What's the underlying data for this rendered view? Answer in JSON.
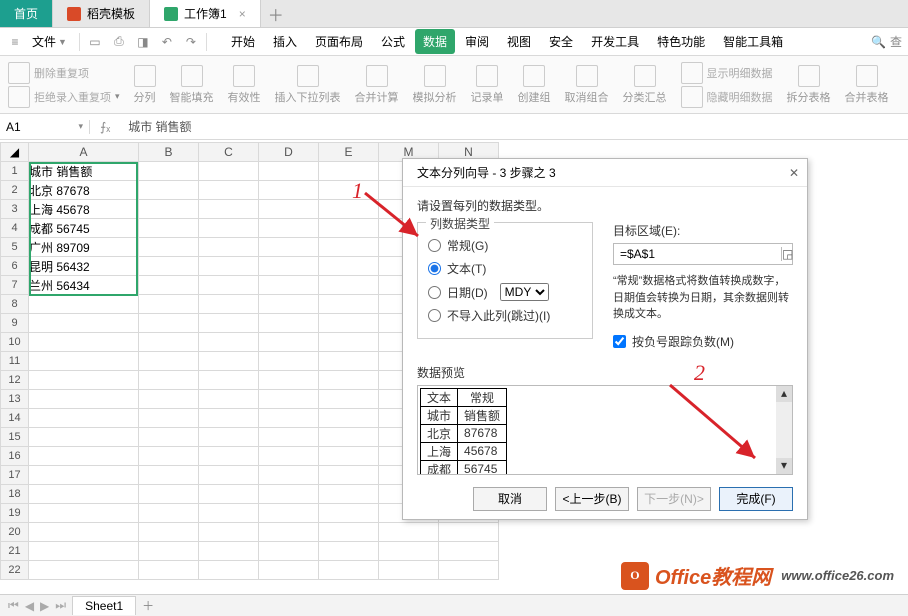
{
  "tabs": {
    "home": "首页",
    "docer": "稻壳模板",
    "workbook": "工作簿1"
  },
  "file_menu": "文件",
  "menus": [
    "开始",
    "插入",
    "页面布局",
    "公式",
    "数据",
    "审阅",
    "视图",
    "安全",
    "开发工具",
    "特色功能",
    "智能工具箱"
  ],
  "search_label": "查",
  "ribbon": {
    "dedup_btn": "删除重复项",
    "reject_dup": "拒绝录入重复项",
    "text_cols": "分列",
    "smartfill": "智能填充",
    "validity": "有效性",
    "insert_dd": "插入下拉列表",
    "consolidate": "合并计算",
    "whatif": "模拟分析",
    "record": "记录单",
    "group": "创建组",
    "ungroup": "取消组合",
    "subtotal": "分类汇总",
    "show_detail": "显示明细数据",
    "hide_detail": "隐藏明细数据",
    "split_tbl": "拆分表格",
    "merge_tbl": "合并表格"
  },
  "namebox": "A1",
  "formula": "城市  销售额",
  "columns": [
    "A",
    "B",
    "C",
    "D",
    "E",
    "M",
    "N"
  ],
  "data": [
    {
      "a": "城市  销售额"
    },
    {
      "a": "北京  87678"
    },
    {
      "a": "上海  45678"
    },
    {
      "a": "成都  56745"
    },
    {
      "a": "广州  89709"
    },
    {
      "a": "昆明  56432"
    },
    {
      "a": "兰州  56434"
    }
  ],
  "dialog": {
    "title": "文本分列向导 - 3 步骤之 3",
    "instruction": "请设置每列的数据类型。",
    "group_label": "列数据类型",
    "opt_general": "常规(G)",
    "opt_text": "文本(T)",
    "opt_date": "日期(D)",
    "date_fmt": "MDY",
    "opt_skip": "不导入此列(跳过)(I)",
    "dest_label": "目标区域(E):",
    "dest_value": "=$A$1",
    "hint": "“常规”数据格式将数值转换成数字，日期值会转换为日期，其余数据则转换成文本。",
    "chk_neg": "按负号跟踪负数(M)",
    "preview_label": "数据预览",
    "preview_headers": [
      "文本",
      "常规"
    ],
    "preview_rows": [
      [
        "城市",
        "销售额"
      ],
      [
        "北京",
        "87678"
      ],
      [
        "上海",
        "45678"
      ],
      [
        "成都",
        "56745"
      ]
    ],
    "btn_cancel": "取消",
    "btn_back": "<上一步(B)",
    "btn_next": "下一步(N)>",
    "btn_finish": "完成(F)"
  },
  "anno1": "1",
  "anno2": "2",
  "sheet": "Sheet1",
  "watermark": {
    "brand": "Office教程网",
    "url": "www.office26.com"
  },
  "chart_data": {
    "type": "table",
    "title": "城市 销售额",
    "series": [
      {
        "name": "销售额",
        "categories": [
          "北京",
          "上海",
          "成都",
          "广州",
          "昆明",
          "兰州"
        ],
        "values": [
          87678,
          45678,
          56745,
          89709,
          56432,
          56434
        ]
      }
    ]
  }
}
